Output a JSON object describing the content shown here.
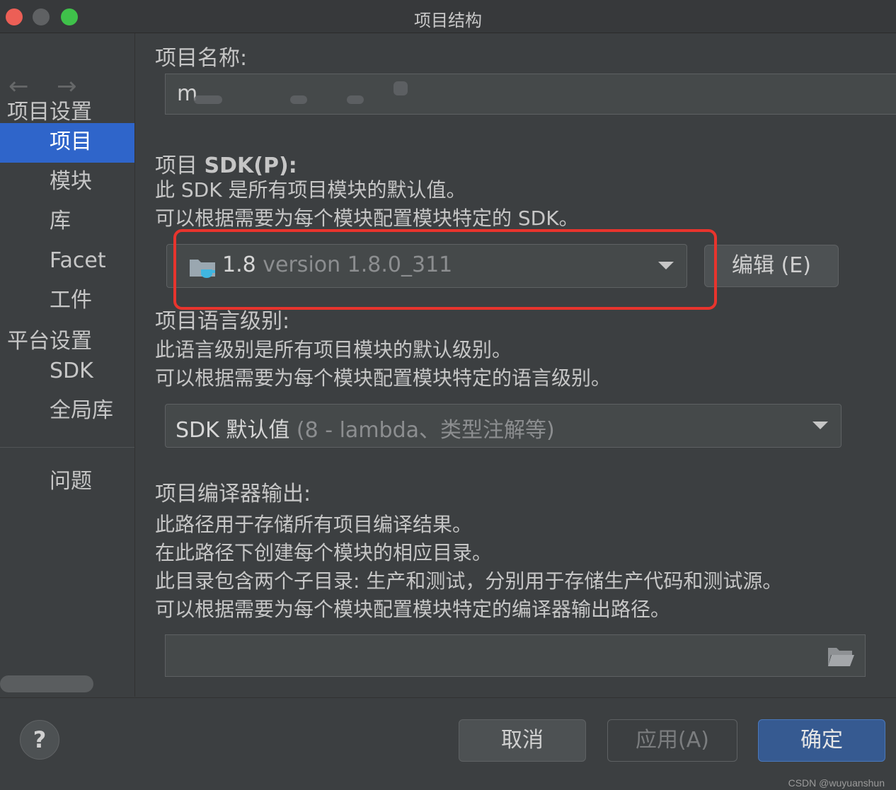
{
  "window": {
    "title": "项目结构"
  },
  "sidebar": {
    "back_arrow": "←",
    "forward_arrow": "→",
    "project_settings_header": "项目设置",
    "project_items": [
      "项目",
      "模块",
      "库",
      "Facet",
      "工件"
    ],
    "platform_settings_header": "平台设置",
    "platform_items": [
      "SDK",
      "全局库"
    ],
    "problems": "问题"
  },
  "project_name": {
    "label": "项目名称:",
    "value": "m"
  },
  "sdk": {
    "label_prefix": "项目 ",
    "label_bold": "SDK(P):",
    "desc": "此 SDK 是所有项目模块的默认值。\n可以根据需要为每个模块配置模块特定的 SDK。",
    "selected_main": "1.8",
    "selected_detail": "version 1.8.0_311",
    "edit_button": "编辑 (E)"
  },
  "language_level": {
    "label": "项目语言级别:",
    "desc": "此语言级别是所有项目模块的默认级别。\n可以根据需要为每个模块配置模块特定的语言级别。",
    "selected_main": "SDK 默认值",
    "selected_detail": "(8 - lambda、类型注解等)"
  },
  "compiler_output": {
    "label": "项目编译器输出:",
    "desc": "此路径用于存储所有项目编译结果。\n在此路径下创建每个模块的相应目录。\n此目录包含两个子目录: 生产和测试，分别用于存储生产代码和测试源。\n可以根据需要为每个模块配置模块特定的编译器输出路径。",
    "value": ""
  },
  "footer": {
    "help": "?",
    "cancel": "取消",
    "apply": "应用(A)",
    "ok": "确定",
    "watermark": "CSDN @wuyuanshun"
  },
  "colors": {
    "background": "#3c3f41",
    "selection": "#2f65ca",
    "highlight_box": "#e8342d",
    "ok_button": "#365a91"
  }
}
